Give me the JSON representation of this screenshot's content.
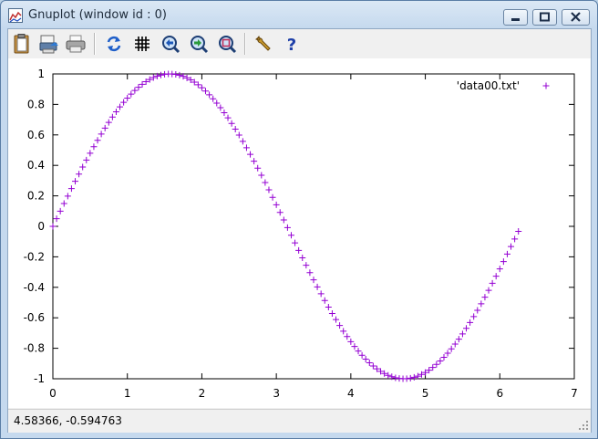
{
  "window": {
    "title": "Gnuplot (window id : 0)",
    "controls": {
      "minimize": "minimize",
      "maximize": "maximize",
      "close": "close"
    }
  },
  "toolbar": {
    "buttons": [
      {
        "id": "copy",
        "icon": "clipboard-icon"
      },
      {
        "id": "print-preview",
        "icon": "print-preview-icon"
      },
      {
        "id": "print",
        "icon": "printer-icon"
      },
      {
        "id": "replot",
        "icon": "replot-icon"
      },
      {
        "id": "grid",
        "icon": "grid-icon"
      },
      {
        "id": "previous-zoom",
        "icon": "zoom-previous-icon"
      },
      {
        "id": "next-zoom",
        "icon": "zoom-next-icon"
      },
      {
        "id": "autoscale",
        "icon": "autoscale-icon"
      },
      {
        "id": "options",
        "icon": "wrench-icon"
      },
      {
        "id": "help",
        "icon": "help-icon"
      }
    ]
  },
  "chart_data": {
    "type": "scatter",
    "series": [
      {
        "name": "'data00.txt'",
        "marker": "+",
        "color": "#9400d3",
        "function": "sin(x)",
        "x_start": 0.0,
        "x_step": 0.05,
        "count": 126
      }
    ],
    "xlim": [
      0,
      7
    ],
    "ylim": [
      -1,
      1
    ],
    "xticks": [
      "0",
      "1",
      "2",
      "3",
      "4",
      "5",
      "6",
      "7"
    ],
    "yticks": [
      "1",
      "0.8",
      "0.6",
      "0.4",
      "0.2",
      "0",
      "-0.2",
      "-0.4",
      "-0.6",
      "-0.8",
      "-1"
    ],
    "legend_position": "top-right",
    "grid": false
  },
  "status": {
    "coordinates": "4.58366, -0.594763"
  }
}
